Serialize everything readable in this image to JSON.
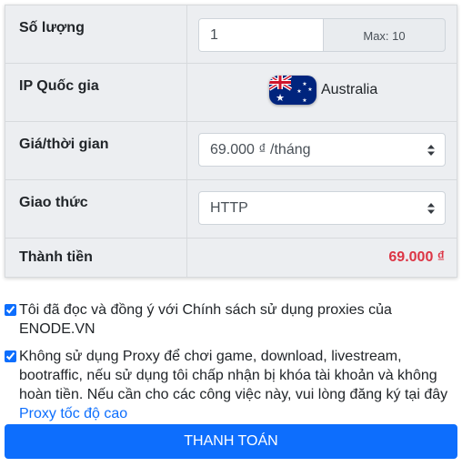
{
  "order": {
    "quantity": {
      "label": "Số lượng",
      "value": "1",
      "max_text": "Max: 10"
    },
    "country": {
      "label": "IP Quốc gia",
      "name": "Australia",
      "flag_icon": "australia-flag-icon"
    },
    "price": {
      "label": "Giá/thời gian",
      "selected": "69.000 ₫ /tháng"
    },
    "protocol": {
      "label": "Giao thức",
      "selected": "HTTP"
    },
    "total": {
      "label": "Thành tiền",
      "value": "69.000 ₫",
      "color": "#dc3545"
    }
  },
  "agreements": [
    {
      "checked": true,
      "text": "Tôi đã đọc và đồng ý với Chính sách sử dụng proxies của ENODE.VN"
    },
    {
      "checked": true,
      "text": "Không sử dụng Proxy để chơi game, download, livestream, bootraffic, nếu sử dụng tôi chấp nhận bị khóa tài khoản và không hoàn tiền. Nếu cần cho các công việc này, vui lòng đăng ký tại đây",
      "link_text": "Proxy tốc độ cao"
    }
  ],
  "pay_button": {
    "label": "THANH TOÁN",
    "color": "#0d6efd"
  }
}
